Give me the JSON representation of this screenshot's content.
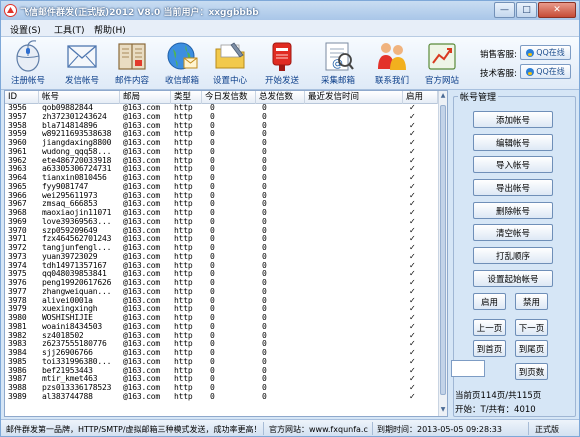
{
  "window": {
    "title": "飞信邮件群发(正式版)2012 V8.0  当前用户：xxggbbbb",
    "controls": [
      "—",
      "□",
      "✕"
    ]
  },
  "menu": [
    {
      "label": "设置(S)"
    },
    {
      "label": "工具(T)"
    },
    {
      "label": "帮助(H)"
    }
  ],
  "toolbar": [
    {
      "label": "注册帐号",
      "icon": "register-mouse-icon"
    },
    {
      "label": "发信帐号",
      "icon": "envelope-icon"
    },
    {
      "label": "邮件内容",
      "icon": "mail-content-book-icon"
    },
    {
      "label": "收信邮箱",
      "icon": "globe-mail-icon"
    },
    {
      "label": "设置中心",
      "icon": "folder-settings-icon"
    },
    {
      "label": "开始发送",
      "icon": "mailbox-send-icon"
    },
    {
      "label": "采集邮箱",
      "icon": "collect-email-icon"
    },
    {
      "label": "联系我们",
      "icon": "contact-people-icon"
    },
    {
      "label": "官方网站",
      "icon": "official-site-icon"
    }
  ],
  "support": [
    {
      "label": "销售客服:",
      "button": "QQ在线"
    },
    {
      "label": "技术客服:",
      "button": "QQ在线"
    }
  ],
  "grid": {
    "columns": [
      "ID",
      "帐号",
      "邮局",
      "类型",
      "今日发信数",
      "总发信数",
      "最近发信时间",
      "启用"
    ],
    "rows": [
      {
        "id": "3956",
        "account": "qob09882844",
        "domain": "@163.com",
        "type": "http",
        "today": "0",
        "total": "0",
        "last": "",
        "enabled": "✓"
      },
      {
        "id": "3957",
        "account": "zh372301243624",
        "domain": "@163.com",
        "type": "http",
        "today": "0",
        "total": "0",
        "last": "",
        "enabled": "✓"
      },
      {
        "id": "3958",
        "account": "bla714814896",
        "domain": "@163.com",
        "type": "http",
        "today": "0",
        "total": "0",
        "last": "",
        "enabled": "✓"
      },
      {
        "id": "3959",
        "account": "w89211693538638",
        "domain": "@163.com",
        "type": "http",
        "today": "0",
        "total": "0",
        "last": "",
        "enabled": "✓"
      },
      {
        "id": "3960",
        "account": "jiangdaxing8800",
        "domain": "@163.com",
        "type": "http",
        "today": "0",
        "total": "0",
        "last": "",
        "enabled": "✓"
      },
      {
        "id": "3961",
        "account": "wudong_qqq58...",
        "domain": "@163.com",
        "type": "http",
        "today": "0",
        "total": "0",
        "last": "",
        "enabled": "✓"
      },
      {
        "id": "3962",
        "account": "ete486720033918",
        "domain": "@163.com",
        "type": "http",
        "today": "0",
        "total": "0",
        "last": "",
        "enabled": "✓"
      },
      {
        "id": "3963",
        "account": "a63305306724731",
        "domain": "@163.com",
        "type": "http",
        "today": "0",
        "total": "0",
        "last": "",
        "enabled": "✓"
      },
      {
        "id": "3964",
        "account": "tianxin0810456",
        "domain": "@163.com",
        "type": "http",
        "today": "0",
        "total": "0",
        "last": "",
        "enabled": "✓"
      },
      {
        "id": "3965",
        "account": "fyy9081747",
        "domain": "@163.com",
        "type": "http",
        "today": "0",
        "total": "0",
        "last": "",
        "enabled": "✓"
      },
      {
        "id": "3966",
        "account": "wei295611973",
        "domain": "@163.com",
        "type": "http",
        "today": "0",
        "total": "0",
        "last": "",
        "enabled": "✓"
      },
      {
        "id": "3967",
        "account": "zmsaq_666853",
        "domain": "@163.com",
        "type": "http",
        "today": "0",
        "total": "0",
        "last": "",
        "enabled": "✓"
      },
      {
        "id": "3968",
        "account": "maoxiaojin11071",
        "domain": "@163.com",
        "type": "http",
        "today": "0",
        "total": "0",
        "last": "",
        "enabled": "✓"
      },
      {
        "id": "3969",
        "account": "love39369563...",
        "domain": "@163.com",
        "type": "http",
        "today": "0",
        "total": "0",
        "last": "",
        "enabled": "✓"
      },
      {
        "id": "3970",
        "account": "szp059209649",
        "domain": "@163.com",
        "type": "http",
        "today": "0",
        "total": "0",
        "last": "",
        "enabled": "✓"
      },
      {
        "id": "3971",
        "account": "fzx464562701243",
        "domain": "@163.com",
        "type": "http",
        "today": "0",
        "total": "0",
        "last": "",
        "enabled": "✓"
      },
      {
        "id": "3972",
        "account": "tangjunfengl...",
        "domain": "@163.com",
        "type": "http",
        "today": "0",
        "total": "0",
        "last": "",
        "enabled": "✓"
      },
      {
        "id": "3973",
        "account": "yuan39723029",
        "domain": "@163.com",
        "type": "http",
        "today": "0",
        "total": "0",
        "last": "",
        "enabled": "✓"
      },
      {
        "id": "3974",
        "account": "tdh14971357167",
        "domain": "@163.com",
        "type": "http",
        "today": "0",
        "total": "0",
        "last": "",
        "enabled": "✓"
      },
      {
        "id": "3975",
        "account": "qq048039853841",
        "domain": "@163.com",
        "type": "http",
        "today": "0",
        "total": "0",
        "last": "",
        "enabled": "✓"
      },
      {
        "id": "3976",
        "account": "peng19920617626",
        "domain": "@163.com",
        "type": "http",
        "today": "0",
        "total": "0",
        "last": "",
        "enabled": "✓"
      },
      {
        "id": "3977",
        "account": "zhangweiquan...",
        "domain": "@163.com",
        "type": "http",
        "today": "0",
        "total": "0",
        "last": "",
        "enabled": "✓"
      },
      {
        "id": "3978",
        "account": "alivei0001a",
        "domain": "@163.com",
        "type": "http",
        "today": "0",
        "total": "0",
        "last": "",
        "enabled": "✓"
      },
      {
        "id": "3979",
        "account": "xuexingxingh",
        "domain": "@163.com",
        "type": "http",
        "today": "0",
        "total": "0",
        "last": "",
        "enabled": "✓"
      },
      {
        "id": "3980",
        "account": "WOSHISHIJIE",
        "domain": "@163.com",
        "type": "http",
        "today": "0",
        "total": "0",
        "last": "",
        "enabled": "✓"
      },
      {
        "id": "3981",
        "account": "woaini8434503",
        "domain": "@163.com",
        "type": "http",
        "today": "0",
        "total": "0",
        "last": "",
        "enabled": "✓"
      },
      {
        "id": "3982",
        "account": "sz4018502",
        "domain": "@163.com",
        "type": "http",
        "today": "0",
        "total": "0",
        "last": "",
        "enabled": "✓"
      },
      {
        "id": "3983",
        "account": "z6237555180776",
        "domain": "@163.com",
        "type": "http",
        "today": "0",
        "total": "0",
        "last": "",
        "enabled": "✓"
      },
      {
        "id": "3984",
        "account": "sjj26906766",
        "domain": "@163.com",
        "type": "http",
        "today": "0",
        "total": "0",
        "last": "",
        "enabled": "✓"
      },
      {
        "id": "3985",
        "account": "toi331996380...",
        "domain": "@163.com",
        "type": "http",
        "today": "0",
        "total": "0",
        "last": "",
        "enabled": "✓"
      },
      {
        "id": "3986",
        "account": "bef21953443",
        "domain": "@163.com",
        "type": "http",
        "today": "0",
        "total": "0",
        "last": "",
        "enabled": "✓"
      },
      {
        "id": "3987",
        "account": "mtir_kmet463",
        "domain": "@163.com",
        "type": "http",
        "today": "0",
        "total": "0",
        "last": "",
        "enabled": "✓"
      },
      {
        "id": "3988",
        "account": "pzs013336178523",
        "domain": "@163.com",
        "type": "http",
        "today": "0",
        "total": "0",
        "last": "",
        "enabled": "✓"
      },
      {
        "id": "3989",
        "account": "al383744788",
        "domain": "@163.com",
        "type": "http",
        "today": "0",
        "total": "0",
        "last": "",
        "enabled": "✓"
      }
    ]
  },
  "side_panel": {
    "title": "帐号管理",
    "buttons": [
      "添加帐号",
      "编辑帐号",
      "导入帐号",
      "导出帐号",
      "删除帐号",
      "清空帐号",
      "打乱顺序",
      "设置起始帐号"
    ],
    "enable_label": "启用",
    "disable_label": "禁用",
    "prev_label": "上一页",
    "next_label": "下一页",
    "first_label": "到首页",
    "last_label": "到尾页",
    "goto_label": "到页数",
    "page_value": "",
    "page_info": "当前页114页/共115页",
    "start_info": "开始：T/共有：4010"
  },
  "status": {
    "slogan": "邮件群发第一品牌，HTTP/SMTP/虚拟邮箱三种模式发送，成功率更高！",
    "website": "官方网站：www.fxqunfa.c",
    "expire": "到期时间：2013-05-05 09:28:33",
    "edition": "正式版"
  },
  "colors": {
    "accent": "#1f4f8f",
    "window_bg": "#d6e6f6",
    "title_bar": "#a9c6e8",
    "close_button": "#c64c37"
  }
}
